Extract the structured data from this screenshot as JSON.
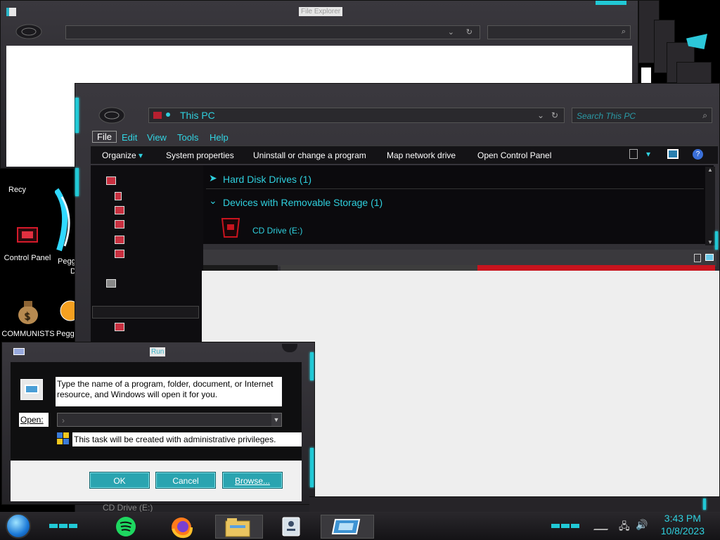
{
  "back_window": {
    "title": "File Explorer"
  },
  "desktop_icons": [
    {
      "label": "Recycle Bin",
      "visible_label": "Recy"
    },
    {
      "label": "Control Panel"
    },
    {
      "label": "Pegg",
      "sub": "De"
    },
    {
      "label": "COMMUNISTS"
    },
    {
      "label": "Pegg"
    }
  ],
  "explorer": {
    "address": "This PC",
    "search_placeholder": "Search This PC",
    "menu": [
      "File",
      "Edit",
      "View",
      "Tools",
      "Help"
    ],
    "toolbar": {
      "organize": "Organize",
      "system_properties": "System properties",
      "uninstall": "Uninstall or change a program",
      "map_drive": "Map network drive",
      "control_panel": "Open Control Panel"
    },
    "groups": {
      "hdd": "Hard Disk Drives (1)",
      "removable": "Devices with Removable Storage (1)"
    },
    "cd_drive": "CD Drive (E:)"
  },
  "run_dialog": {
    "title": "Run",
    "description": "Type the name of a program, folder, document, or Internet resource, and Windows will open it for you.",
    "open_label": "Open:",
    "admin_note": "This task will be created with administrative privileges.",
    "ok": "OK",
    "cancel": "Cancel",
    "browse": "Browse..."
  },
  "taskbar": {
    "time": "3:43 PM",
    "date": "10/8/2023",
    "apps": [
      "spotify",
      "firefox",
      "file-explorer",
      "media-device",
      "run"
    ],
    "behind_run_text": "CD Drive (E:)"
  },
  "colors": {
    "accent": "#2fd0de",
    "chrome": "#2a282c",
    "alert": "#c8141e"
  }
}
